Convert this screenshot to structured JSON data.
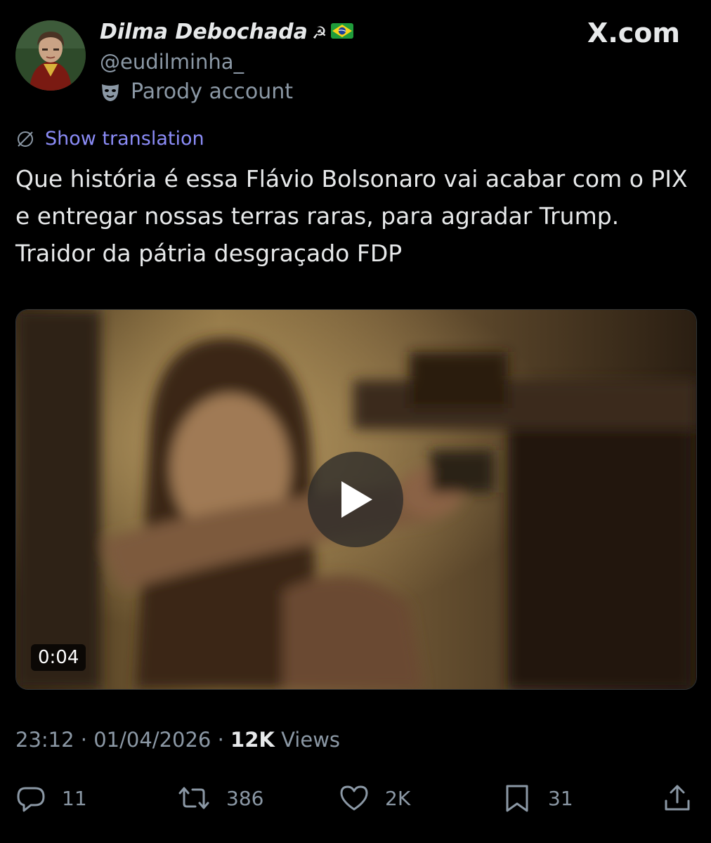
{
  "author": {
    "display_name": "Dilma Debochada",
    "name_emoji": "☭",
    "flag_icon": "brazil-flag-icon",
    "handle": "@eudilminha_",
    "parody_label": "Parody account",
    "avatar_icon": "profile-photo"
  },
  "brand": "X.com",
  "translate": {
    "label": "Show translation",
    "icon": "globe-icon"
  },
  "tweet": {
    "text": "Que história é essa Flávio Bolsonaro vai acabar com o PIX e entregar nossas terras raras, para agradar Trump. Traidor da pátria desgraçado FDP"
  },
  "media": {
    "duration": "0:04",
    "play_icon": "play-icon"
  },
  "meta": {
    "time": "23:12",
    "separator": "·",
    "date": "01/04/2026",
    "views_count": "12K",
    "views_label": "Views"
  },
  "actions": {
    "replies": "11",
    "reposts": "386",
    "likes": "2K",
    "bookmarks": "31"
  },
  "colors": {
    "background": "#000000",
    "text": "#e7e9ea",
    "muted": "#8b98a5",
    "link": "#8b8cf7"
  }
}
